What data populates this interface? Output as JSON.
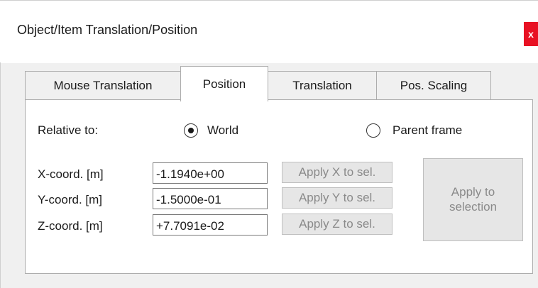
{
  "window": {
    "title": "Object/Item Translation/Position",
    "close_label": "x"
  },
  "tabs": [
    {
      "label": "Mouse Translation",
      "active": false
    },
    {
      "label": "Position",
      "active": true
    },
    {
      "label": "Translation",
      "active": false
    },
    {
      "label": "Pos. Scaling",
      "active": false
    }
  ],
  "relative_to": {
    "label": "Relative to:",
    "options": [
      {
        "label": "World",
        "selected": true
      },
      {
        "label": "Parent frame",
        "selected": false
      }
    ]
  },
  "coords": [
    {
      "label": "X-coord. [m]",
      "value": "-1.1940e+00",
      "apply_label": "Apply X to sel."
    },
    {
      "label": "Y-coord. [m]",
      "value": "-1.5000e-01",
      "apply_label": "Apply Y to sel."
    },
    {
      "label": "Z-coord. [m]",
      "value": "+7.7091e-02",
      "apply_label": "Apply Z to sel."
    }
  ],
  "apply_selection": {
    "line1": "Apply to",
    "line2": "selection"
  }
}
